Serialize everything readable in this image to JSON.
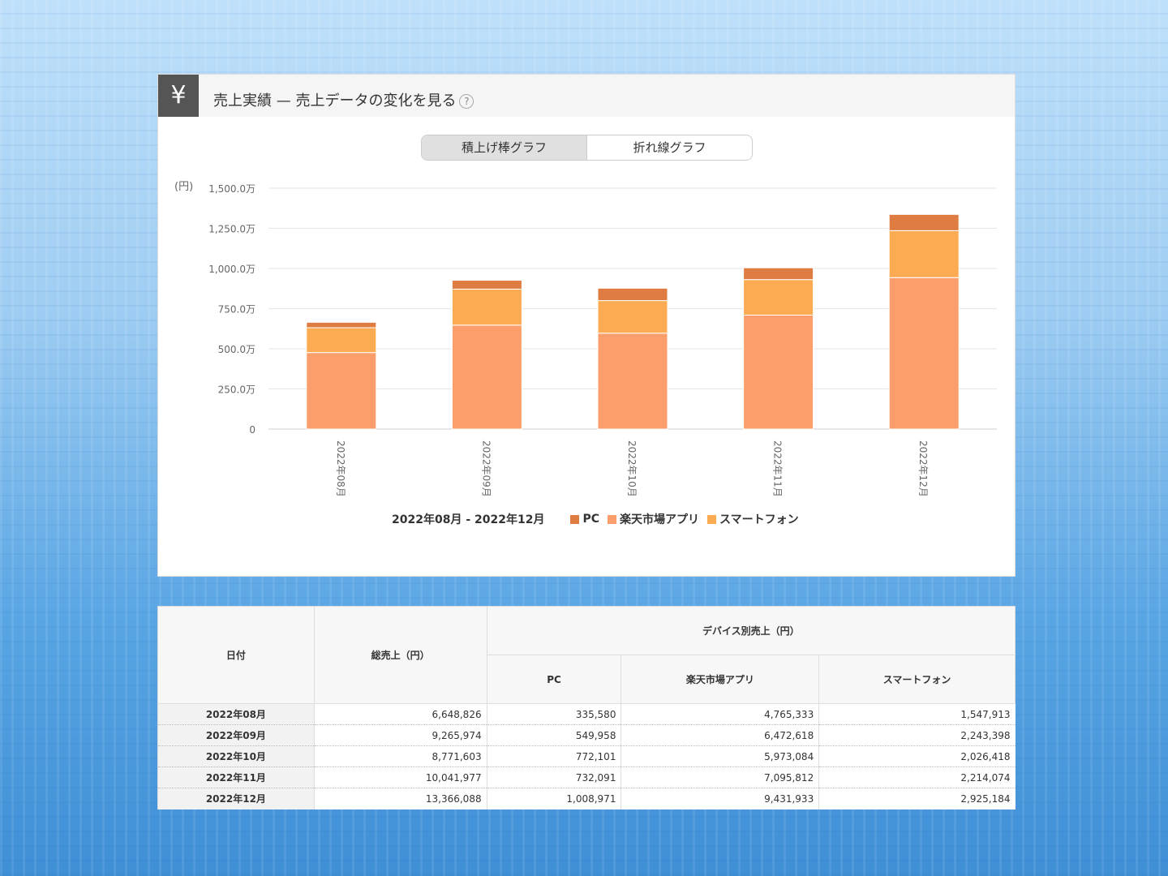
{
  "header": {
    "icon": "yen-icon",
    "icon_glyph": "¥",
    "title": "売上実績 — 売上データの変化を見る",
    "help": "?"
  },
  "toggle": {
    "stacked": "積上げ棒グラフ",
    "line": "折れ線グラフ"
  },
  "chart_data": {
    "type": "bar",
    "stacked": true,
    "ylabel": "(円)",
    "ylim": [
      0,
      15000000
    ],
    "yticks": [
      {
        "v": 0,
        "label": "0"
      },
      {
        "v": 2500000,
        "label": "250.0万"
      },
      {
        "v": 5000000,
        "label": "500.0万"
      },
      {
        "v": 7500000,
        "label": "750.0万"
      },
      {
        "v": 10000000,
        "label": "1,000.0万"
      },
      {
        "v": 12500000,
        "label": "1,250.0万"
      },
      {
        "v": 15000000,
        "label": "1,500.0万"
      }
    ],
    "categories": [
      "2022年08月",
      "2022年09月",
      "2022年10月",
      "2022年11月",
      "2022年12月"
    ],
    "series": [
      {
        "name": "楽天市場アプリ",
        "color": "#fb9e6b",
        "values": [
          4765333,
          6472618,
          5973084,
          7095812,
          9431933
        ]
      },
      {
        "name": "スマートフォン",
        "color": "#fcab52",
        "values": [
          1547913,
          2243398,
          2026418,
          2214074,
          2925184
        ]
      },
      {
        "name": "PC",
        "color": "#df7c41",
        "values": [
          335580,
          549958,
          772101,
          732091,
          1008971
        ]
      }
    ],
    "legend_title": "2022年08月 - 2022年12月",
    "legend_order": [
      "PC",
      "楽天市場アプリ",
      "スマートフォン"
    ],
    "legend_colors": [
      "#df7c41",
      "#fb9e6b",
      "#fcab52"
    ],
    "grid": true,
    "legend": "bottom"
  },
  "table": {
    "h_date": "日付",
    "h_total": "総売上（円）",
    "h_device": "デバイス別売上（円）",
    "h_pc": "PC",
    "h_app": "楽天市場アプリ",
    "h_phone": "スマートフォン",
    "rows": [
      [
        "2022年08月",
        "6,648,826",
        "335,580",
        "4,765,333",
        "1,547,913"
      ],
      [
        "2022年09月",
        "9,265,974",
        "549,958",
        "6,472,618",
        "2,243,398"
      ],
      [
        "2022年10月",
        "8,771,603",
        "772,101",
        "5,973,084",
        "2,026,418"
      ],
      [
        "2022年11月",
        "10,041,977",
        "732,091",
        "7,095,812",
        "2,214,074"
      ],
      [
        "2022年12月",
        "13,366,088",
        "1,008,971",
        "9,431,933",
        "2,925,184"
      ]
    ]
  }
}
